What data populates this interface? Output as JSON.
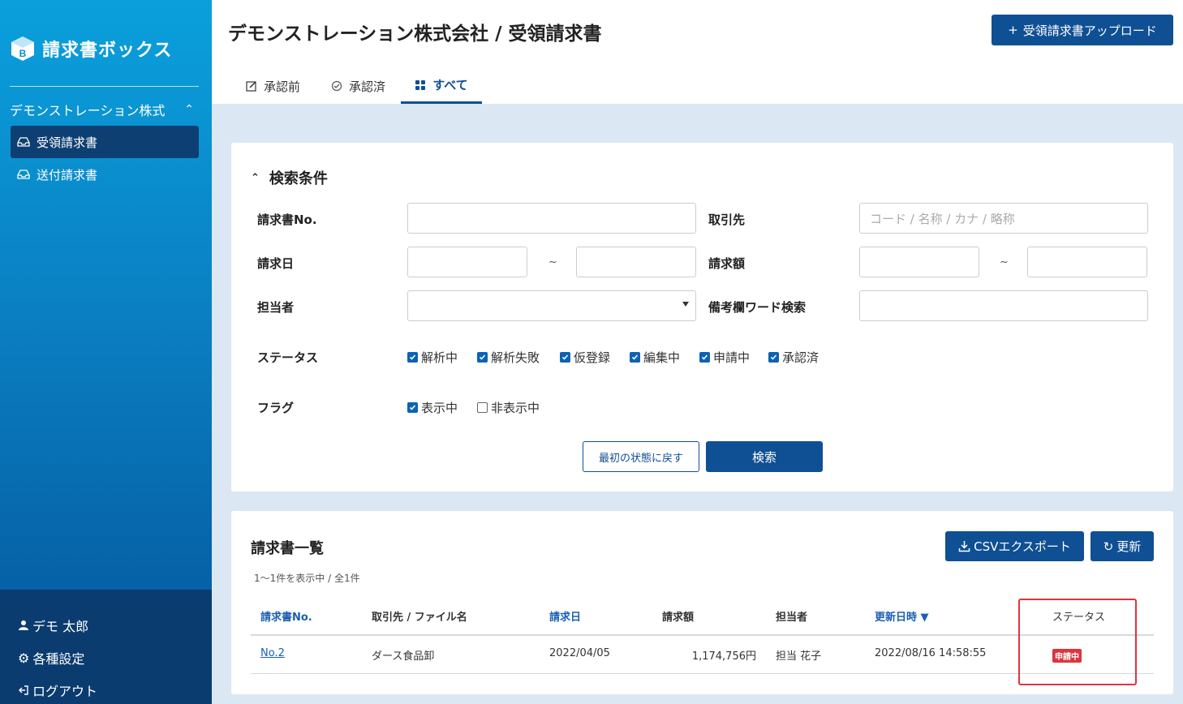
{
  "app": {
    "brand": "請求書ボックス"
  },
  "sidebar": {
    "company": "デモンストレーション株式",
    "items": [
      {
        "label": "受領請求書",
        "active": true
      },
      {
        "label": "送付請求書",
        "active": false
      }
    ],
    "bottom": {
      "user": "デモ 太郎",
      "settings": "各種設定",
      "logout": "ログアウト"
    }
  },
  "header": {
    "title": "デモンストレーション株式会社 / 受領請求書",
    "upload_button": "受領請求書アップロード",
    "tabs": [
      {
        "label": "承認前",
        "icon": "edit-icon",
        "active": false
      },
      {
        "label": "承認済",
        "icon": "check-circle-icon",
        "active": false
      },
      {
        "label": "すべて",
        "icon": "grid-icon",
        "active": true
      }
    ]
  },
  "search": {
    "title": "検索条件",
    "labels": {
      "invoice_no": "請求書No.",
      "partner": "取引先",
      "invoice_date": "請求日",
      "amount": "請求額",
      "assignee": "担当者",
      "memo": "備考欄ワード検索",
      "status": "ステータス",
      "flag": "フラグ"
    },
    "partner_placeholder": "コード / 名称 / カナ / 略称",
    "range_sep": "~",
    "statuses": [
      {
        "label": "解析中",
        "checked": true
      },
      {
        "label": "解析失敗",
        "checked": true
      },
      {
        "label": "仮登録",
        "checked": true
      },
      {
        "label": "編集中",
        "checked": true
      },
      {
        "label": "申請中",
        "checked": true
      },
      {
        "label": "承認済",
        "checked": true
      }
    ],
    "flags": [
      {
        "label": "表示中",
        "checked": true
      },
      {
        "label": "非表示中",
        "checked": false
      }
    ],
    "reset_button": "最初の状態に戻す",
    "search_button": "検索"
  },
  "list": {
    "title": "請求書一覧",
    "count": "1〜1件を表示中 / 全1件",
    "csv_button": "CSVエクスポート",
    "refresh_button": "更新",
    "columns": {
      "no": "請求書No.",
      "partner": "取引先 / ファイル名",
      "date": "請求日",
      "amount": "請求額",
      "assignee": "担当者",
      "updated": "更新日時 ▼",
      "status": "ステータス"
    },
    "rows": [
      {
        "no": "No.2",
        "partner": "ダース食品卸",
        "date": "2022/04/05",
        "amount": "1,174,756円",
        "assignee": "担当 花子",
        "updated": "2022/08/16 14:58:55",
        "status": "申請中"
      }
    ]
  },
  "colors": {
    "primary": "#0f4f94",
    "sidebar_top": "#0aa0dc",
    "sidebar_bottom": "#0b3c70",
    "status_badge": "#d9363e",
    "highlight": "#e0343c"
  }
}
